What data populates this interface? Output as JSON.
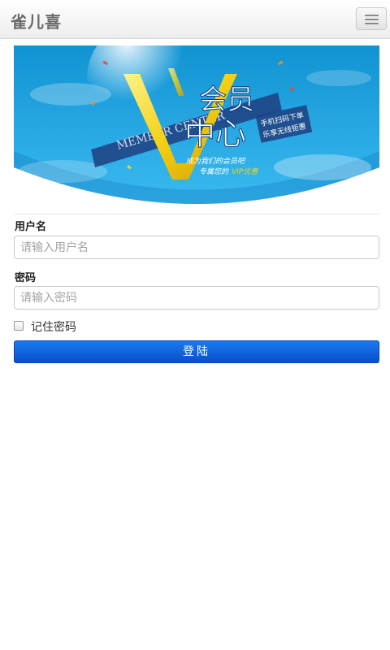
{
  "navbar": {
    "brand": "雀儿喜",
    "toggle_icon": "hamburger-menu-icon"
  },
  "banner": {
    "title_line1": "会员",
    "title_line2": "中心",
    "ribbon_text": "MEMBER CENTER",
    "side_line1": "手机扫码下单",
    "side_line2": "乐享无线钜惠",
    "slogan_line1": "成为我们的会员吧",
    "slogan_line2_prefix": "专属您的",
    "slogan_line2_highlight": "VIP优惠",
    "colors": {
      "sky_top": "#1495d4",
      "sky_bottom": "#35b4ea",
      "gold": "#f3d51a",
      "ribbon": "#1e3f80"
    }
  },
  "form": {
    "username_label": "用户名",
    "username_placeholder": "请输入用户名",
    "username_value": "",
    "password_label": "密码",
    "password_placeholder": "请输入密码",
    "password_value": "",
    "remember_label": "记住密码",
    "remember_checked": false,
    "login_button": "登陆"
  }
}
